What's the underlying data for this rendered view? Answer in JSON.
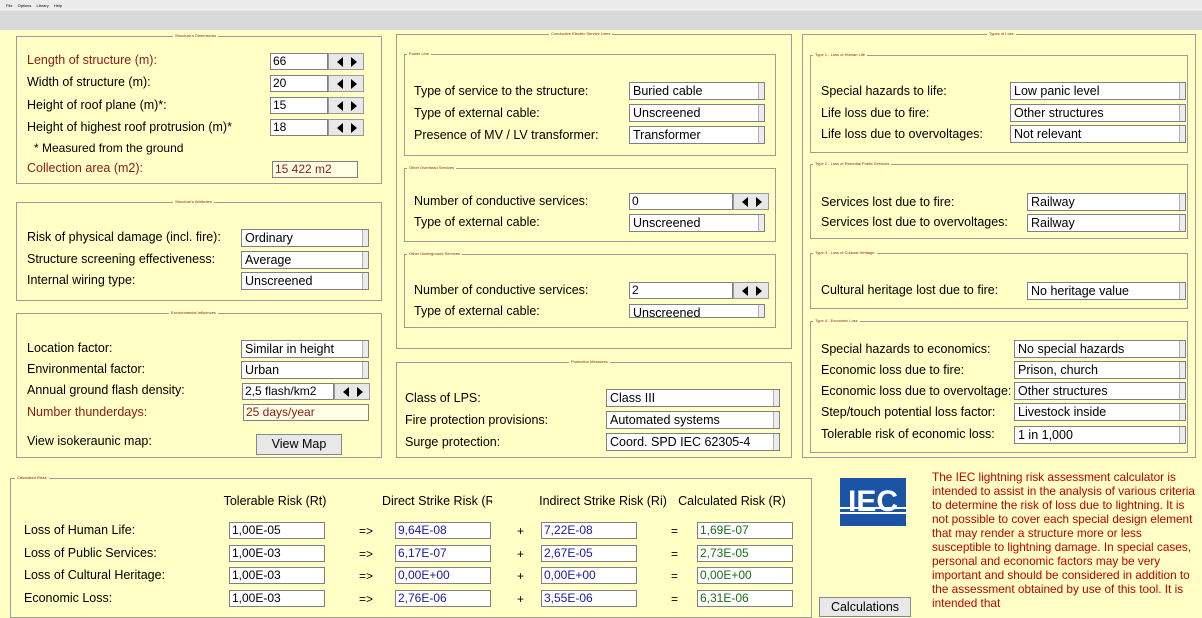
{
  "menu": [
    "File",
    "Options",
    "Library",
    "Help"
  ],
  "dim": {
    "title": "Structure's Dimensions",
    "length_lbl": "Length of structure (m):",
    "length": "66",
    "width_lbl": "Width of structure (m):",
    "width": "20",
    "roof_lbl": "Height of roof plane (m)*:",
    "roof": "15",
    "prot_lbl": "Height of highest roof protrusion (m)*",
    "prot": "18",
    "note": "* Measured from the ground",
    "area_lbl": "Collection area (m2):",
    "area": "15 422 m2"
  },
  "attr": {
    "title": "Structure's Attributes",
    "risk_lbl": "Risk of physical damage (incl. fire):",
    "risk": "Ordinary",
    "screen_lbl": "Structure screening effectiveness:",
    "screen": "Average",
    "wiring_lbl": "Internal wiring type:",
    "wiring": "Unscreened"
  },
  "env": {
    "title": "Environmental Influences",
    "loc_lbl": "Location factor:",
    "loc": "Similar in height",
    "envf_lbl": "Environmental factor:",
    "envf": "Urban",
    "flash_lbl": "Annual ground flash density:",
    "flash": "2,5 flash/km2",
    "thunder_lbl": "Number thunderdays:",
    "thunder": "25 days/year",
    "map_lbl": "View isokeraunic map:",
    "map_btn": "View Map"
  },
  "cond": {
    "title": "Conductive Electric Service Lines",
    "power_title": "Power Line",
    "service_lbl": "Type of service to the structure:",
    "service": "Buried cable",
    "cable_lbl": "Type of external cable:",
    "cable": "Unscreened",
    "trans_lbl": "Presence of MV / LV transformer:",
    "trans": "Transformer",
    "ovh_title": "Other Overhead Services",
    "ovh_num_lbl": "Number of conductive services:",
    "ovh_num": "0",
    "ovh_cable_lbl": "Type of external cable:",
    "ovh_cable": "Unscreened",
    "und_title": "Other Underground Services",
    "und_num_lbl": "Number of conductive services:",
    "und_num": "2",
    "und_cable_lbl": "Type of external cable:",
    "und_cable": "Unscreened"
  },
  "prot": {
    "title": "Protection Measures",
    "lps_lbl": "Class of LPS:",
    "lps": "Class III",
    "fire_lbl": "Fire protection provisions:",
    "fire": "Automated systems",
    "surge_lbl": "Surge protection:",
    "surge": "Coord. SPD IEC 62305-4"
  },
  "loss": {
    "title": "Types of Loss",
    "t1": "Type 1 - Loss of Human Life",
    "sh_lbl": "Special hazards to life:",
    "sh": "Low panic level",
    "llf_lbl": "Life loss due to fire:",
    "llf": "Other structures",
    "llo_lbl": "Life loss due to overvoltages:",
    "llo": "Not relevant",
    "t2": "Type 2 - Loss of Essential Public Services",
    "slf_lbl": "Services lost due to fire:",
    "slf": "Railway",
    "slo_lbl": "Services lost due to overvoltages:",
    "slo": "Railway",
    "t3": "Type 3 - Loss of Cultural Heritage",
    "chl_lbl": "Cultural heritage lost due to fire:",
    "chl": "No heritage value",
    "t4": "Type 4 - Economic Loss",
    "she_lbl": "Special hazards to economics:",
    "she": "No special hazards",
    "elf_lbl": "Economic loss due to fire:",
    "elf": "Prison, church",
    "elo_lbl": "Economic loss due to overvoltage:",
    "elo": "Other structures",
    "stp_lbl": "Step/touch potential loss factor:",
    "stp": "Livestock inside",
    "tol_lbl": "Tolerable risk of economic loss:",
    "tol": "1 in 1,000"
  },
  "calc": {
    "title": "Calculated Risks",
    "h_tol": "Tolerable Risk (Rt)",
    "h_direct": "Direct Strike Risk (Rd)",
    "h_indirect": "Indirect Strike Risk (Ri)",
    "h_calc": "Calculated Risk (R)",
    "arrow": "=>",
    "plus": "+",
    "eq": "=",
    "rows": [
      {
        "label": "Loss of Human Life:",
        "rt": "1,00E-05",
        "rd": "9,64E-08",
        "ri": "7,22E-08",
        "r": "1,69E-07"
      },
      {
        "label": "Loss of Public Services:",
        "rt": "1,00E-03",
        "rd": "6,17E-07",
        "ri": "2,67E-05",
        "r": "2,73E-05"
      },
      {
        "label": "Loss of Cultural Heritage:",
        "rt": "1,00E-03",
        "rd": "0,00E+00",
        "ri": "0,00E+00",
        "r": "0,00E+00"
      },
      {
        "label": "Economic Loss:",
        "rt": "1,00E-03",
        "rd": "2,76E-06",
        "ri": "3,55E-06",
        "r": "6,31E-06"
      }
    ]
  },
  "logo": "IEC",
  "calc_btn": "Calculations",
  "info": "The IEC lightning risk assessment calculator is intended to assist in the analysis of various criteria to determine the risk of loss due to lightning. It is not possible to cover each special design element that may render a structure more or less susceptible to lightning damage. In special cases, personal and economic factors may be very important and should be considered in addition to the assessment obtained by use of this tool. It is intended that",
  "colors": {
    "bg": "#ffffc6",
    "rd_text": "#1a1a9e",
    "r_text": "#1a6e1a",
    "info_text": "#c00000",
    "logo_bg": "#1b53a5"
  }
}
